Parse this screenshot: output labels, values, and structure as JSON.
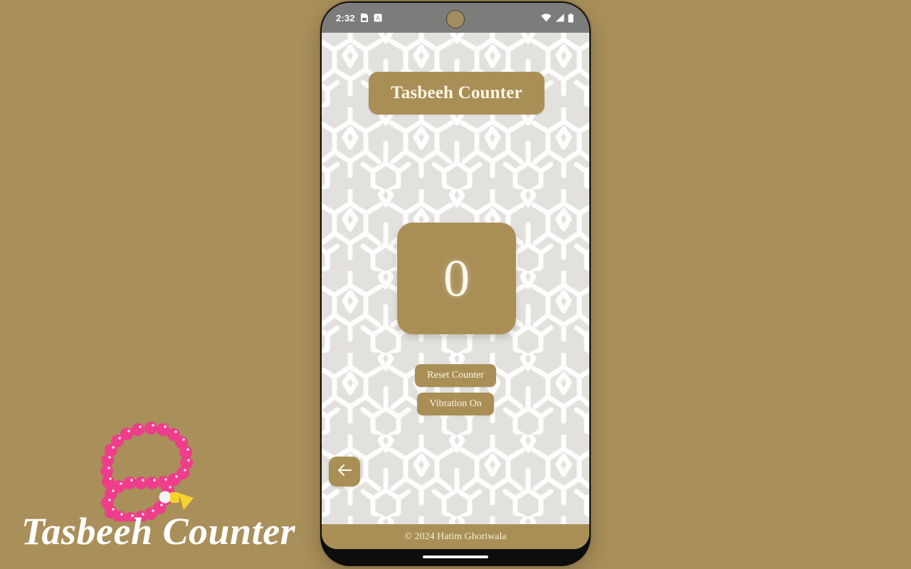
{
  "branding": {
    "logo_icon": "prayer-beads-tasbeeh-icon",
    "title": "Tasbeeh Counter",
    "bead_color": "#ee3d8a",
    "tassel_color": "#f6d22e",
    "background_color": "#a98f59"
  },
  "phone": {
    "status_bar": {
      "clock": "2:32",
      "left_icons": [
        "sim-card-icon",
        "screenshot-icon"
      ],
      "right_icons": [
        "wifi-icon",
        "cellular-signal-icon",
        "battery-icon"
      ],
      "camera_icon": "punch-hole-camera-icon",
      "background_color": "#7c7c7a"
    },
    "nav": {
      "home_indicator": "home-indicator"
    }
  },
  "app": {
    "accent_color": "#a98f56",
    "screen_background_color": "#e2e1de",
    "pattern": "islamic-geometric-pattern",
    "header": {
      "title": "Tasbeeh Counter"
    },
    "counter": {
      "value": "0",
      "label": "counter-display"
    },
    "buttons": {
      "reset_label": "Reset Counter",
      "vibration_label": "Vibration On"
    },
    "back": {
      "icon": "arrow-left-icon"
    },
    "footer": {
      "copyright": "© 2024 Hatim Ghoriwala"
    }
  }
}
